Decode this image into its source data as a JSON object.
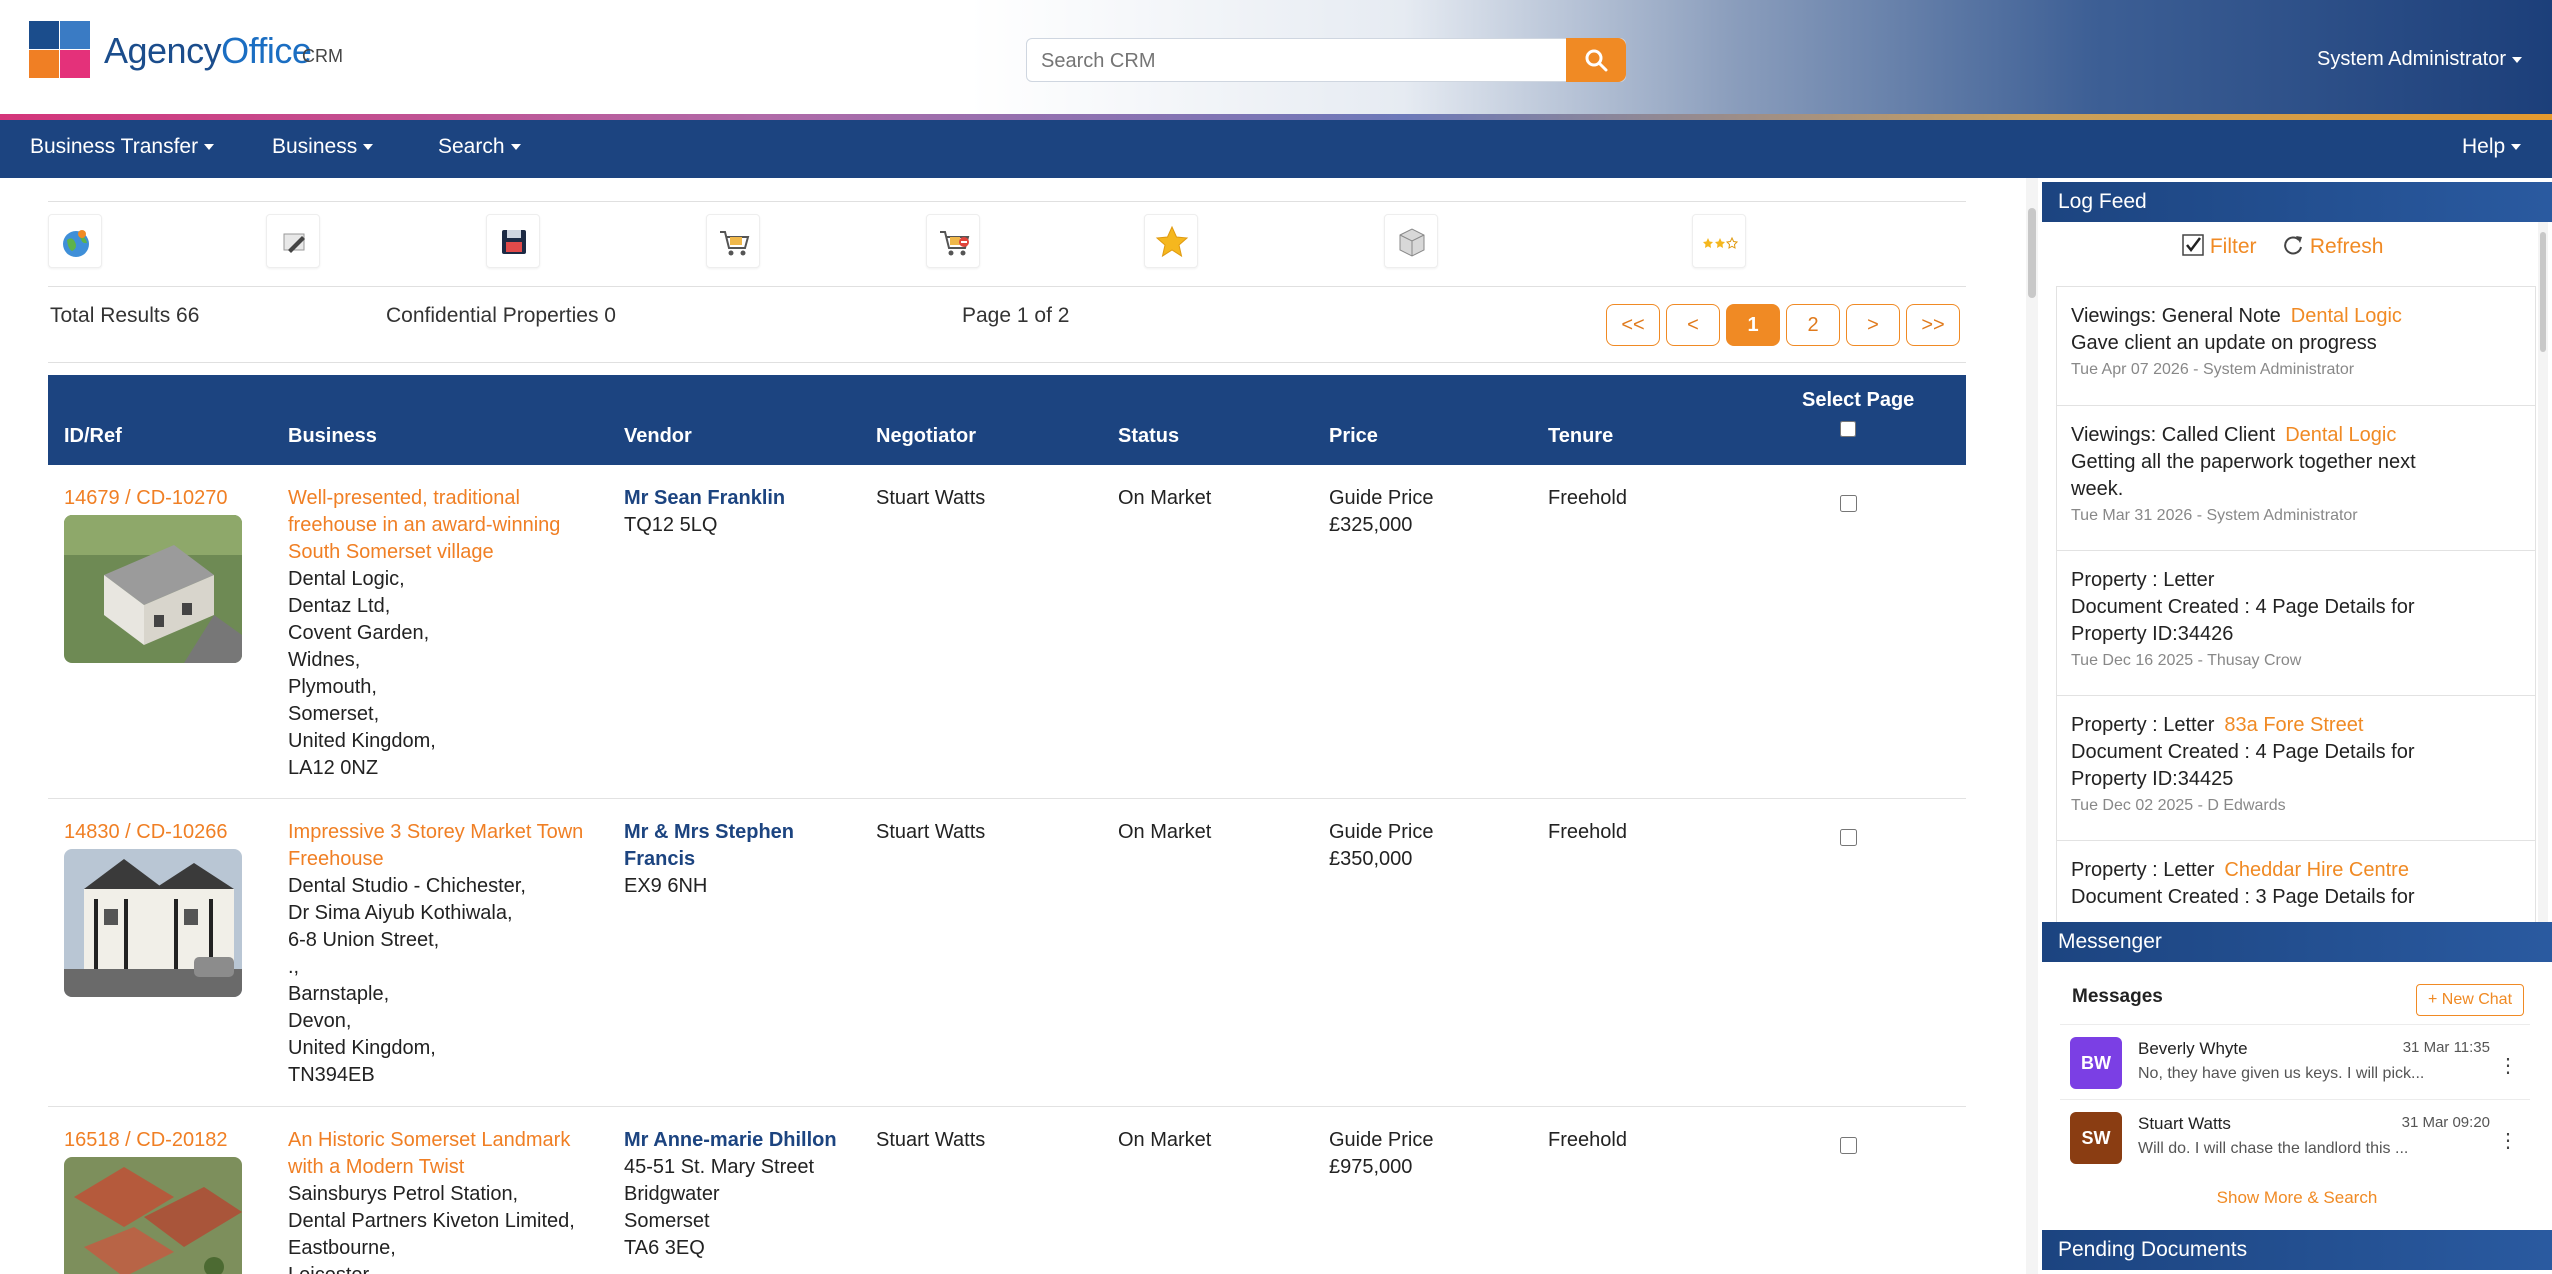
{
  "header": {
    "brand_agency": "Agency",
    "brand_office": "Office",
    "brand_suffix": "CRM",
    "search_placeholder": "Search CRM",
    "user": "System Administrator"
  },
  "nav": {
    "items": [
      "Business Transfer",
      "Business",
      "Search"
    ],
    "help": "Help"
  },
  "toolbar": {
    "icons": [
      "globe-icon",
      "edit-icon",
      "save-icon",
      "cart-add-icon",
      "cart-remove-icon",
      "star-icon",
      "box-icon",
      "rating-stars-icon"
    ]
  },
  "results": {
    "total": "Total Results 66",
    "confidential": "Confidential Properties 0",
    "page": "Page 1 of 2",
    "pager": [
      "<<",
      "<",
      "1",
      "2",
      ">",
      ">>"
    ]
  },
  "table": {
    "headers": {
      "id": "ID/Ref",
      "business": "Business",
      "vendor": "Vendor",
      "negotiator": "Negotiator",
      "status": "Status",
      "price": "Price",
      "tenure": "Tenure",
      "select": "Select Page"
    },
    "rows": [
      {
        "ref": "14679 / CD-10270",
        "title": [
          "Well-presented, traditional",
          "freehouse in an award-winning",
          "South Somerset village"
        ],
        "address": [
          "Dental Logic,",
          "Dentaz Ltd,",
          "Covent Garden,",
          "Widnes,",
          "Plymouth,",
          "Somerset,",
          "United Kingdom,",
          "LA12 0NZ"
        ],
        "vendor_name": [
          "Mr Sean Franklin"
        ],
        "vendor_address": [
          "TQ12 5LQ"
        ],
        "negotiator": "Stuart Watts",
        "status": "On Market",
        "price_label": "Guide Price",
        "price": "£325,000",
        "tenure": "Freehold"
      },
      {
        "ref": "14830 / CD-10266",
        "title": [
          "Impressive 3 Storey Market Town",
          "Freehouse"
        ],
        "address": [
          "Dental Studio - Chichester,",
          "Dr Sima Aiyub Kothiwala,",
          "6-8 Union Street,",
          ".,",
          "Barnstaple,",
          "Devon,",
          "United Kingdom,",
          "TN394EB"
        ],
        "vendor_name": [
          "Mr & Mrs Stephen",
          "Francis"
        ],
        "vendor_address": [
          "EX9 6NH"
        ],
        "negotiator": "Stuart Watts",
        "status": "On Market",
        "price_label": "Guide Price",
        "price": "£350,000",
        "tenure": "Freehold"
      },
      {
        "ref": "16518 / CD-20182",
        "title": [
          "An Historic Somerset Landmark",
          "with a Modern Twist"
        ],
        "address": [
          "Sainsburys Petrol Station,",
          "Dental Partners Kiveton Limited,",
          "Eastbourne,",
          "Leicester,"
        ],
        "vendor_name": [
          "Mr Anne-marie Dhillon"
        ],
        "vendor_address": [
          "45-51 St. Mary Street",
          "Bridgwater",
          "Somerset",
          "TA6 3EQ"
        ],
        "negotiator": "Stuart Watts",
        "status": "On Market",
        "price_label": "Guide Price",
        "price": "£975,000",
        "tenure": "Freehold"
      }
    ]
  },
  "log_feed": {
    "title": "Log Feed",
    "filter": "Filter",
    "refresh": "Refresh",
    "items": [
      {
        "title": "Viewings: General Note",
        "link": "Dental Logic",
        "body": [
          "Gave client an update on progress"
        ],
        "meta": "Tue Apr 07 2026 - System Administrator"
      },
      {
        "title": "Viewings: Called Client",
        "link": "Dental Logic",
        "body": [
          "Getting all the paperwork together next",
          "week."
        ],
        "meta": "Tue Mar 31 2026 - System Administrator"
      },
      {
        "title": "Property : Letter",
        "link": "",
        "body": [
          "Document Created : 4 Page Details for",
          "Property ID:34426"
        ],
        "meta": "Tue Dec 16 2025 - Thusay Crow"
      },
      {
        "title": "Property : Letter",
        "link": "83a Fore Street",
        "body": [
          "Document Created : 4 Page Details for",
          "Property ID:34425"
        ],
        "meta": "Tue Dec 02 2025 - D Edwards"
      },
      {
        "title": "Property : Letter",
        "link": "Cheddar Hire Centre",
        "body": [
          "Document Created : 3 Page Details for"
        ],
        "meta": ""
      }
    ]
  },
  "messenger": {
    "title": "Messenger",
    "messages_label": "Messages",
    "new_chat": "+ New Chat",
    "chats": [
      {
        "initials": "BW",
        "name": "Beverly Whyte",
        "time": "31 Mar 11:35",
        "preview": "No, they have given us keys. I will pick...",
        "color": "#7b3fe4"
      },
      {
        "initials": "SW",
        "name": "Stuart Watts",
        "time": "31 Mar 09:20",
        "preview": "Will do. I will chase the landlord this ...",
        "color": "#8a3d12"
      }
    ],
    "show_more": "Show More & Search"
  },
  "pending": {
    "title": "Pending Documents"
  },
  "colors": {
    "navy": "#1c4480",
    "orange": "#f08a24"
  }
}
